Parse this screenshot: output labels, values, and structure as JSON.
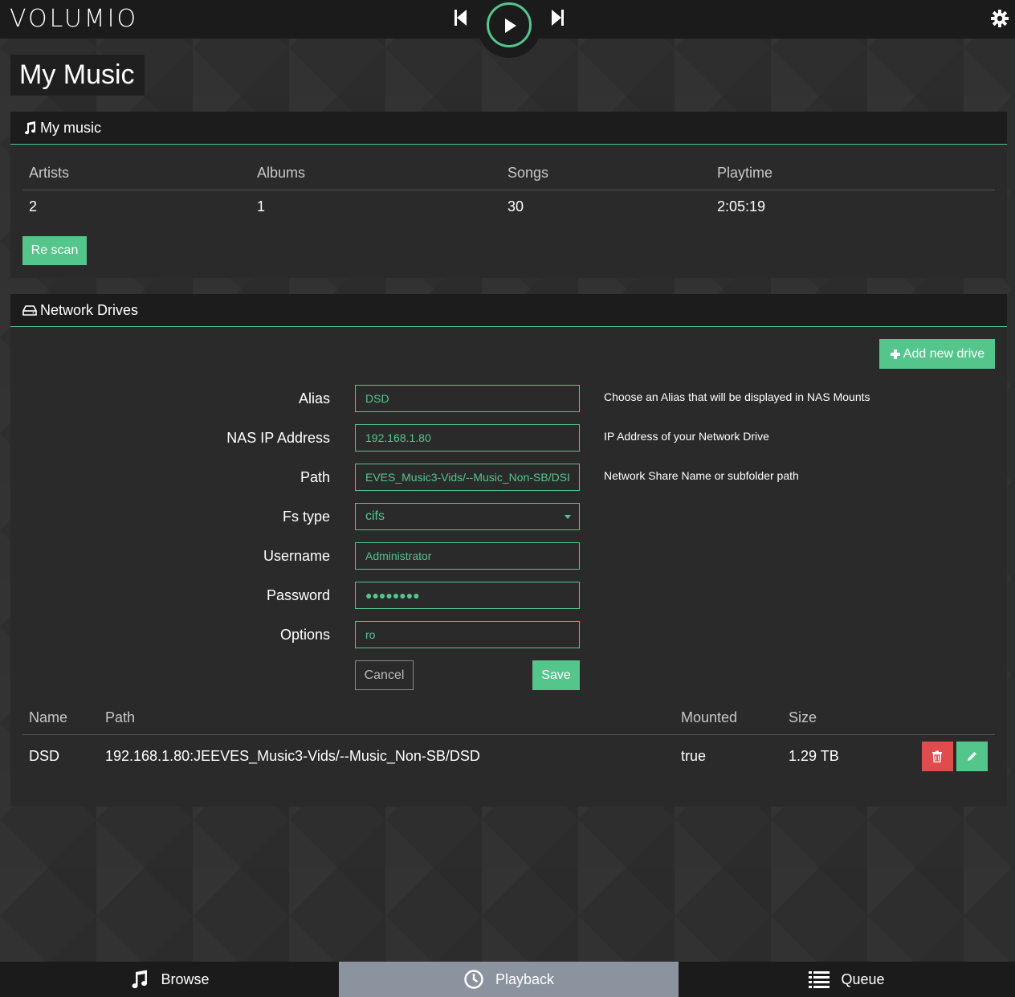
{
  "app": {
    "logo": "VOLUMIO"
  },
  "player": {
    "prev_icon": "skip-back-icon",
    "play_icon": "play-icon",
    "next_icon": "skip-forward-icon",
    "settings_icon": "gear-icon"
  },
  "page": {
    "title": "My Music"
  },
  "my_music": {
    "title": "My music",
    "icon": "music-note-icon",
    "headers": {
      "artists": "Artists",
      "albums": "Albums",
      "songs": "Songs",
      "playtime": "Playtime"
    },
    "values": {
      "artists": "2",
      "albums": "1",
      "songs": "30",
      "playtime": "2:05:19"
    },
    "rescan_label": "Re scan"
  },
  "network_drives": {
    "title": "Network Drives",
    "icon": "hdd-icon",
    "add_label": "Add new drive",
    "form": {
      "alias": {
        "label": "Alias",
        "value": "DSD",
        "help": "Choose an Alias that will be displayed in NAS Mounts"
      },
      "ip": {
        "label": "NAS IP Address",
        "value": "192.168.1.80",
        "help": "IP Address of your Network Drive"
      },
      "path": {
        "label": "Path",
        "value": "EVES_Music3-Vids/--Music_Non-SB/DSI",
        "help": "Network Share Name or subfolder path"
      },
      "fstype": {
        "label": "Fs type",
        "value": "cifs"
      },
      "username": {
        "label": "Username",
        "value": "Administrator"
      },
      "password": {
        "label": "Password",
        "value": "●●●●●●●●"
      },
      "options": {
        "label": "Options",
        "value": "ro"
      },
      "cancel_label": "Cancel",
      "save_label": "Save"
    },
    "table": {
      "headers": {
        "name": "Name",
        "path": "Path",
        "mounted": "Mounted",
        "size": "Size"
      },
      "rows": [
        {
          "name": "DSD",
          "path": "192.168.1.80:JEEVES_Music3-Vids/--Music_Non-SB/DSD",
          "mounted": "true",
          "size": "1.29 TB"
        }
      ]
    }
  },
  "nav": {
    "browse": "Browse",
    "playback": "Playback",
    "queue": "Queue"
  },
  "colors": {
    "accent": "#54c68c",
    "danger": "#e04b4b",
    "active_tab": "#8a939e"
  }
}
